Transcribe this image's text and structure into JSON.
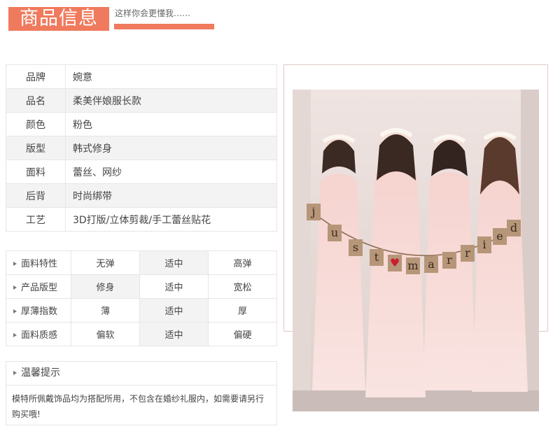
{
  "header": {
    "title": "商品信息",
    "subtitle": "这样你会更懂我……"
  },
  "specs": [
    {
      "key": "品牌",
      "value": "婉意"
    },
    {
      "key": "品名",
      "value": "柔美伴娘服长款"
    },
    {
      "key": "颜色",
      "value": "粉色"
    },
    {
      "key": "版型",
      "value": "韩式修身"
    },
    {
      "key": "面料",
      "value": "蕾丝、网纱"
    },
    {
      "key": "后背",
      "value": "时尚绑带"
    },
    {
      "key": "工艺",
      "value": "3D打版/立体剪裁/手工蕾丝贴花"
    }
  ],
  "attributes": [
    {
      "label": "面料特性",
      "options": [
        "无弹",
        "适中",
        "高弹"
      ],
      "selected": 1
    },
    {
      "label": "产品版型",
      "options": [
        "修身",
        "适中",
        "宽松"
      ],
      "selected": 0
    },
    {
      "label": "厚薄指数",
      "options": [
        "薄",
        "适中",
        "厚"
      ],
      "selected": 1
    },
    {
      "label": "面料质感",
      "options": [
        "偏软",
        "适中",
        "偏硬"
      ],
      "selected": 1
    }
  ],
  "tip": {
    "title": "温馨提示",
    "text": "模特所佩戴饰品均为搭配所用，不包含在婚纱礼服内，如需要请另行购买哦!"
  },
  "photo": {
    "banner_letters": [
      "j",
      "u",
      "s",
      "t",
      "♥",
      "m",
      "a",
      "r",
      "r",
      "i",
      "e",
      "d"
    ],
    "colors": {
      "dress": "#f7d9d6",
      "wall": "#e9dcd8",
      "accent": "#f07a5d"
    }
  }
}
